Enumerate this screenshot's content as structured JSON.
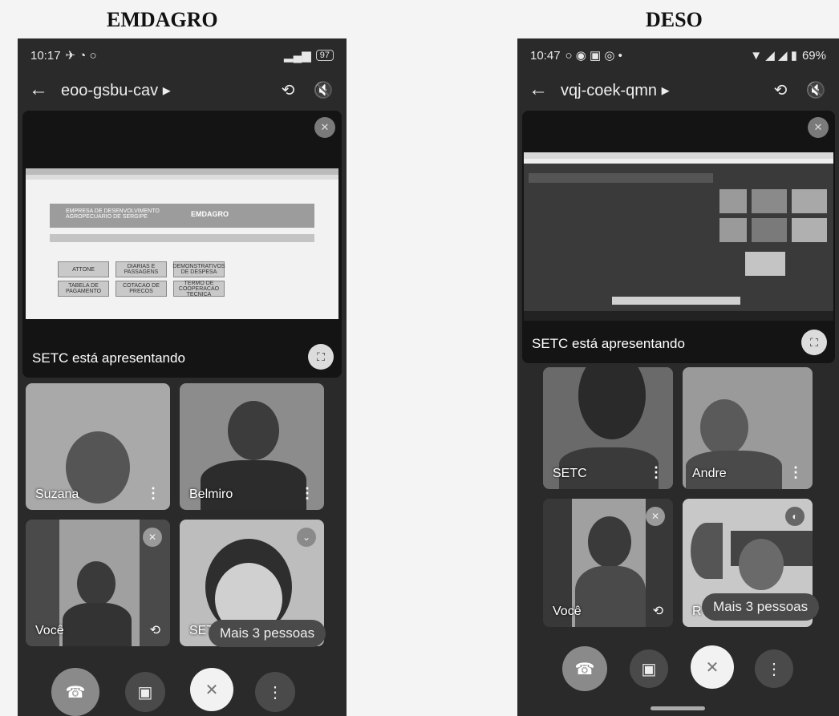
{
  "labels": {
    "left": "EMDAGRO",
    "right": "DESO"
  },
  "phone_left": {
    "status_time": "10:17",
    "status_battery": "97",
    "meeting_code": "eoo-gsbu-cav ▸",
    "presenting_text": "SETC está apresentando",
    "site_title": "EMPRESA DE DESENVOLVIMENTO AGROPECUARIO DE SERGIPE",
    "site_brand": "EMDAGRO",
    "site_boxes": [
      "ATTONE",
      "DIARIAS E PASSAGENS",
      "DEMONSTRATIVOS DE DESPESA",
      "TABELA DE PAGAMENTO",
      "COTACAO DE PRECOS",
      "TERMO DE COOPERACAO TECNICA"
    ],
    "tiles": [
      {
        "name": "Suzana"
      },
      {
        "name": "Belmiro"
      },
      {
        "name": "Você"
      },
      {
        "name": "SET"
      }
    ],
    "more_people": "Mais 3 pessoas"
  },
  "phone_right": {
    "status_time": "10:47",
    "status_battery": "69%",
    "meeting_code": "vqj-coek-qmn ▸",
    "presenting_text": "SETC está apresentando",
    "tiles": [
      {
        "name": "SETC"
      },
      {
        "name": "Andre"
      },
      {
        "name": "Você"
      },
      {
        "name": "R"
      }
    ],
    "more_people": "Mais 3 pessoas"
  },
  "icons": {
    "back": "←",
    "camera_flip": "⟲",
    "speaker_off": "🔇",
    "mic_off": "✕",
    "more": "⋮",
    "hangup": "☎",
    "video": "▣",
    "fullscreen": "⛶"
  }
}
